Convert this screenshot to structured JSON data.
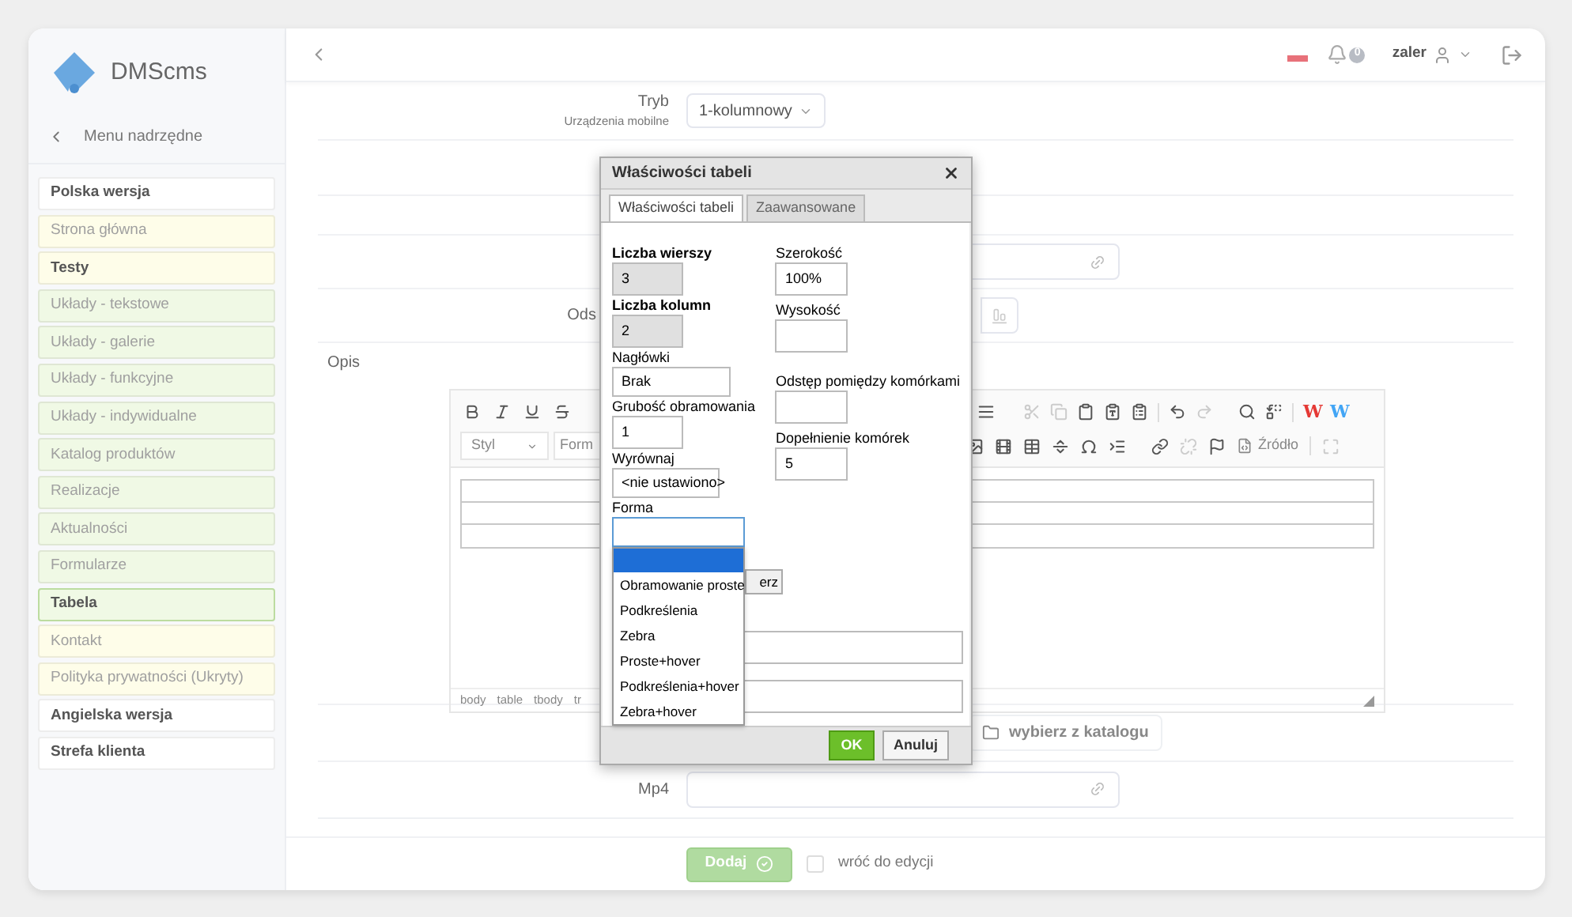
{
  "sidebar": {
    "logo": "DMScms",
    "back_link": "Menu nadrzędne",
    "items": [
      {
        "label": "Polska wersja",
        "kind": "section",
        "color": "#ffffff",
        "selected": false
      },
      {
        "label": "Strona główna",
        "kind": "page",
        "color": "#fefde9",
        "selected": false
      },
      {
        "label": "Testy",
        "kind": "section",
        "color": "#fefde9",
        "selected": false
      },
      {
        "label": "Układy - tekstowe",
        "kind": "page",
        "color": "#f0f9e5",
        "selected": false
      },
      {
        "label": "Układy - galerie",
        "kind": "page",
        "color": "#f0f9e5",
        "selected": false
      },
      {
        "label": "Układy - funkcyjne",
        "kind": "page",
        "color": "#f0f9e5",
        "selected": false
      },
      {
        "label": "Układy - indywidualne",
        "kind": "page",
        "color": "#f0f9e5",
        "selected": false
      },
      {
        "label": "Katalog produktów",
        "kind": "page",
        "color": "#f0f9e5",
        "selected": false
      },
      {
        "label": "Realizacje",
        "kind": "page",
        "color": "#f0f9e5",
        "selected": false
      },
      {
        "label": "Aktualności",
        "kind": "page",
        "color": "#f0f9e5",
        "selected": false
      },
      {
        "label": "Formularze",
        "kind": "page",
        "color": "#f0f9e5",
        "selected": false
      },
      {
        "label": "Tabela",
        "kind": "page",
        "color": "#f0f9e5",
        "selected": true
      },
      {
        "label": "Kontakt",
        "kind": "page",
        "color": "#fefde9",
        "selected": false
      },
      {
        "label": "Polityka prywatności (Ukryty)",
        "kind": "page",
        "color": "#fefde9",
        "selected": false
      },
      {
        "label": "Angielska wersja",
        "kind": "section",
        "color": "#ffffff",
        "selected": false
      },
      {
        "label": "Strefa klienta",
        "kind": "section",
        "color": "#ffffff",
        "selected": false
      }
    ]
  },
  "header": {
    "notifications": "0",
    "user": "zaler"
  },
  "mode_field": {
    "label": "Tryb",
    "sublabel": "Urządzenia mobilne",
    "value": "1-kolumnowy"
  },
  "partial_label": "Ods",
  "description": {
    "label": "Opis",
    "style_combo": "Styl",
    "format_combo": "Form",
    "source_button": "Źródło",
    "word_buttons": [
      {
        "label": "W",
        "color": "#e53935"
      },
      {
        "label": "W",
        "color": "#42a5f5"
      }
    ],
    "path": [
      "body",
      "table",
      "tbody",
      "tr"
    ]
  },
  "catalog_button": "wybierz z katalogu",
  "mp4_field": {
    "label": "Mp4"
  },
  "submit": {
    "label": "Dodaj",
    "disabled": true
  },
  "return_checkbox": {
    "label": "wróć do edycji",
    "checked": false
  },
  "dialog": {
    "title": "Właściwości tabeli",
    "tabs": [
      {
        "label": "Właściwości tabeli",
        "selected": true
      },
      {
        "label": "Zaawansowane",
        "selected": false
      }
    ],
    "left_fields": [
      {
        "label": "Liczba wierszy",
        "value": "3",
        "kind": "input",
        "required": true,
        "disabled": true,
        "focused": false
      },
      {
        "label": "Liczba kolumn",
        "value": "2",
        "kind": "input",
        "required": true,
        "disabled": true,
        "focused": false
      },
      {
        "label": "Nagłówki",
        "value": "Brak",
        "kind": "select",
        "required": false,
        "disabled": false,
        "focused": false
      },
      {
        "label": "Grubość obramowania",
        "value": "1",
        "kind": "input",
        "required": false,
        "disabled": false,
        "focused": false
      },
      {
        "label": "Wyrównaj",
        "value": "<nie ustawiono>",
        "kind": "select",
        "required": false,
        "disabled": false,
        "focused": false
      },
      {
        "label": "Forma",
        "kind": "dropdown",
        "required": false,
        "disabled": false,
        "focused": true
      }
    ],
    "right_fields": [
      {
        "label": "Szerokość",
        "value": "100%"
      },
      {
        "label": "Wysokość"
      },
      {
        "label": "Odstęp pomiędzy komórkami"
      },
      {
        "label": "Dopełnienie komórek",
        "value": "5"
      }
    ],
    "blank_option": {
      "selected": true
    },
    "options": [
      {
        "label": "Obramowanie proste",
        "selected": false
      },
      {
        "label": "Podkreślenia",
        "selected": false
      },
      {
        "label": "Zebra",
        "selected": false
      },
      {
        "label": "Proste+hover",
        "selected": false
      },
      {
        "label": "Podkreślenia+hover",
        "selected": false
      },
      {
        "label": "Zebra+hover",
        "selected": false
      }
    ],
    "partial_button": "erz",
    "ok": "OK",
    "cancel": "Anuluj"
  }
}
